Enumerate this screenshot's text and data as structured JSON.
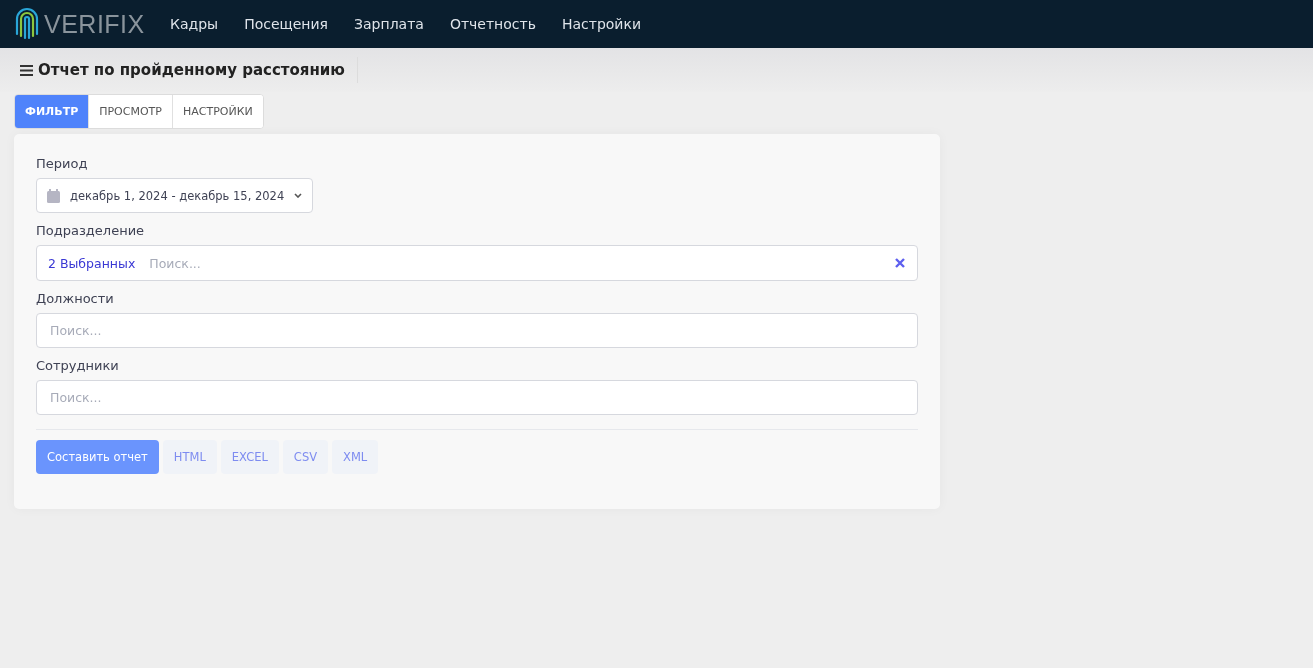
{
  "navbar": {
    "logo_text": "VERIFIX",
    "menu": [
      {
        "label": "Кадры"
      },
      {
        "label": "Посещения"
      },
      {
        "label": "Зарплата"
      },
      {
        "label": "Отчетность"
      },
      {
        "label": "Настройки"
      }
    ]
  },
  "page": {
    "title": "Отчет по пройденному расстоянию"
  },
  "tabs": [
    {
      "label": "ФИЛЬТР",
      "selected": true
    },
    {
      "label": "ПРОСМОТР",
      "selected": false
    },
    {
      "label": "НАСТРОЙКИ",
      "selected": false
    }
  ],
  "filters": [
    {
      "kind": "daterange",
      "label": "Период",
      "value": "декабрь 1, 2024 - декабрь 15, 2024"
    },
    {
      "kind": "multiselect",
      "label": "Подразделение",
      "selected_text": "2 Выбранных",
      "placeholder": "Поиск..."
    },
    {
      "kind": "search",
      "label": "Должности",
      "placeholder": "Поиск..."
    },
    {
      "kind": "search",
      "label": "Сотрудники",
      "placeholder": "Поиск..."
    }
  ],
  "actions": [
    {
      "kind": "primary",
      "label": "Составить отчет"
    },
    {
      "kind": "format",
      "label": "HTML"
    },
    {
      "kind": "format",
      "label": "EXCEL"
    },
    {
      "kind": "format",
      "label": "CSV"
    },
    {
      "kind": "format",
      "label": "XML"
    }
  ]
}
